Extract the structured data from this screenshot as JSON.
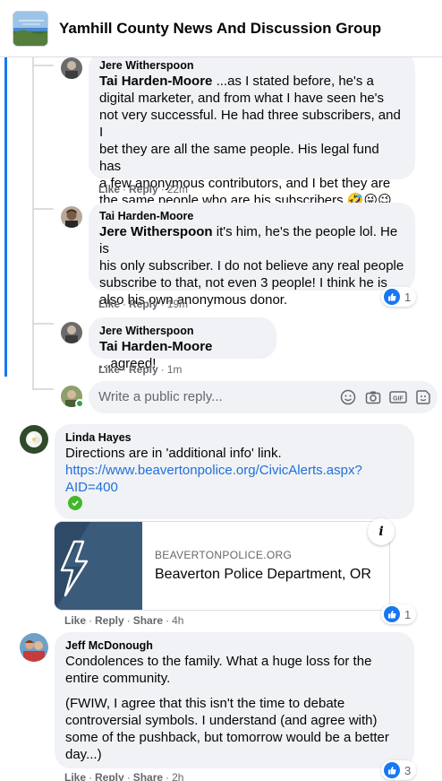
{
  "header": {
    "title": "Yamhill County News And Discussion Group"
  },
  "replies": [
    {
      "author": "Jere Witherspoon",
      "mention": "Tai Harden-Moore",
      "lines": [
        " ...as I stated before, he's a",
        "digital marketer, and from what I have seen he's",
        "not very successful. He had three subscribers, and I",
        "bet they are all the same people. His legal fund has",
        "a few anonymous contributors, and I bet they are",
        "the same people who are his subscribers 🤣😜😉"
      ],
      "like": "Like",
      "reply": "Reply",
      "time": "22m"
    },
    {
      "author": "Tai Harden-Moore",
      "mention": "Jere Witherspoon",
      "lines": [
        " it's him, he's the people lol. He is",
        "his only subscriber. I do not believe any real people",
        "subscribe to that, not even 3 people! I think he is",
        "also his own anonymous donor."
      ],
      "like": "Like",
      "reply": "Reply",
      "time": "19m",
      "reaction_count": "1"
    },
    {
      "author": "Jere Witherspoon",
      "mention": "Tai Harden-Moore",
      "lines": [
        " ...agreed!"
      ],
      "like": "Like",
      "reply": "Reply",
      "time": "1m"
    }
  ],
  "reply_box": {
    "placeholder": "Write a public reply..."
  },
  "comments": [
    {
      "author": "Linda Hayes",
      "text": "Directions are in 'additional info' link.",
      "link_line1": "https://www.beavertonpolice.org/CivicAlerts.aspx?",
      "link_line2": "AID=400",
      "card": {
        "domain": "BEAVERTONPOLICE.ORG",
        "title": "Beaverton Police Department, OR"
      },
      "like": "Like",
      "reply": "Reply",
      "share": "Share",
      "time": "4h",
      "reaction_count": "1"
    },
    {
      "author": "Jeff McDonough",
      "lines1": [
        "Condolences to the family. What a huge loss for the",
        "entire community."
      ],
      "lines2": [
        "(FWIW, I agree that this isn't the time to debate",
        "controversial symbols. I understand (and agree with)",
        "some of the pushback, but tomorrow would be a better",
        "day...)"
      ],
      "like": "Like",
      "reply": "Reply",
      "share": "Share",
      "time": "2h",
      "reaction_count": "3"
    }
  ],
  "colors": {
    "accent": "#1877f2",
    "bubble": "#f0f2f5",
    "link": "#216fdb",
    "meta": "#65676b"
  },
  "icons": [
    "emoji-icon",
    "camera-icon",
    "gif-icon",
    "sticker-icon",
    "like-icon",
    "info-icon",
    "verified-check-icon"
  ]
}
